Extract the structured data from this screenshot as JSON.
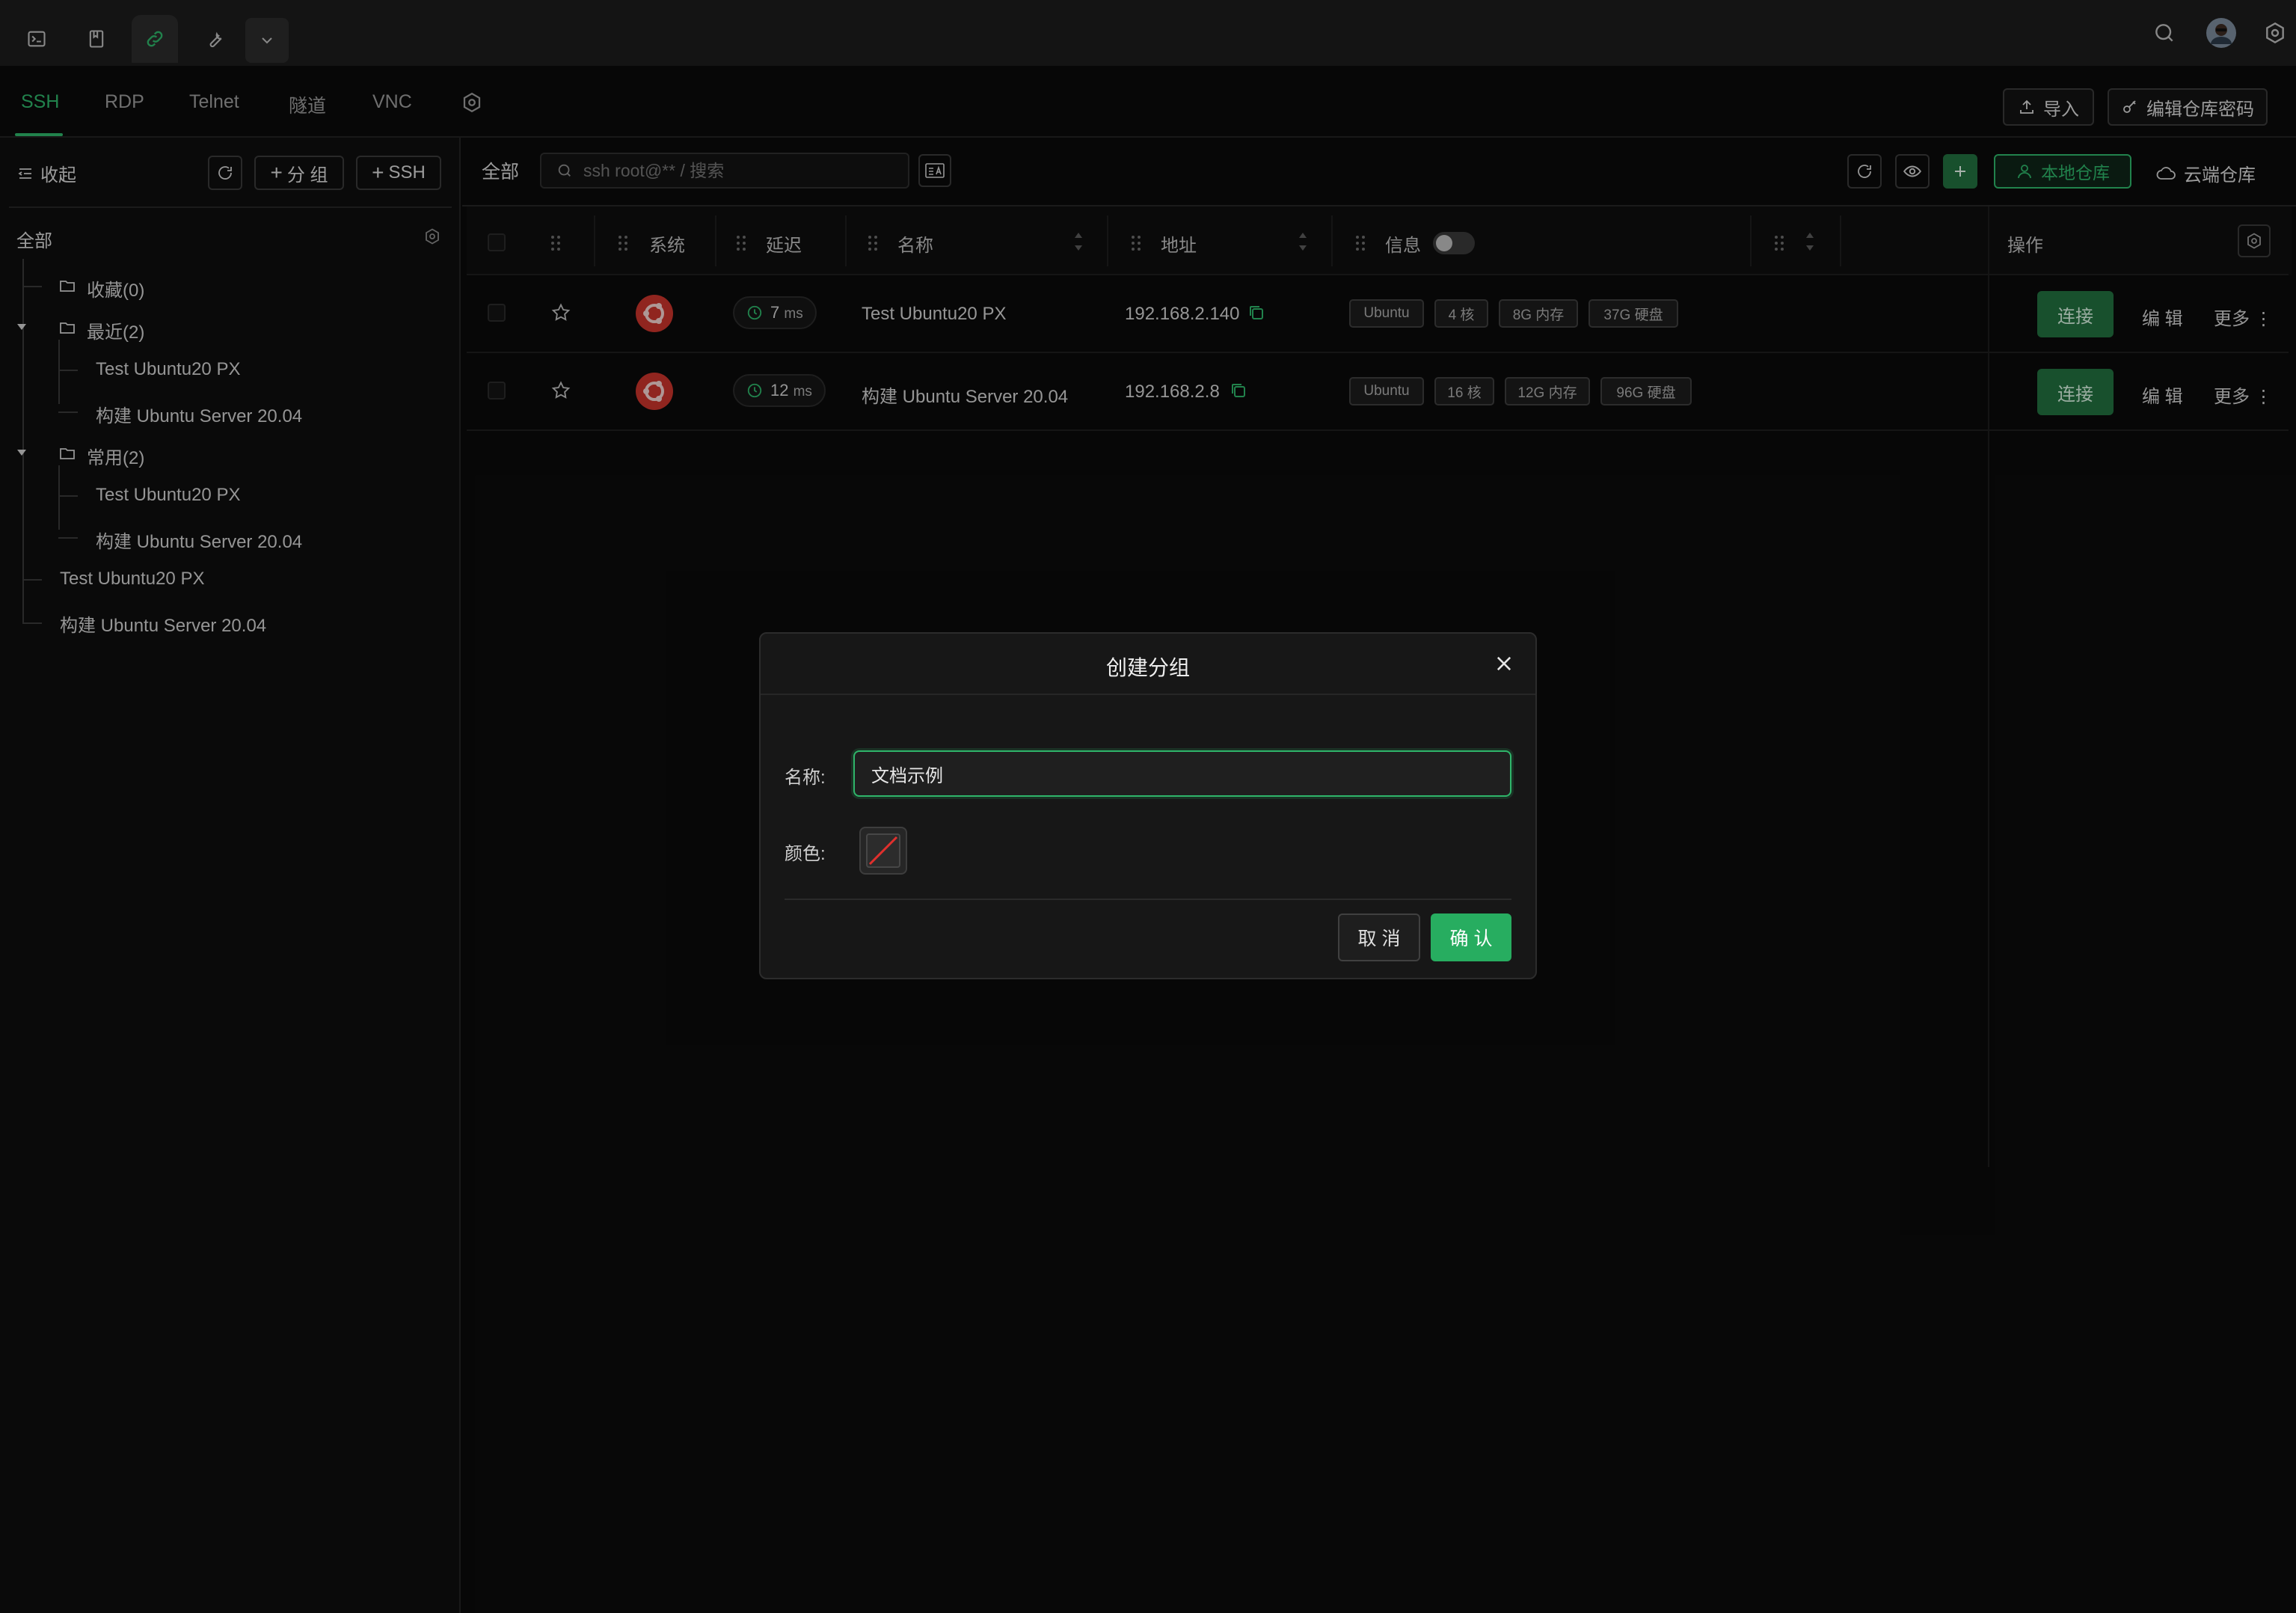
{
  "colors": {
    "accent": "#2fb56a",
    "connect": "#226f3f",
    "ubuntu": "#c8342b",
    "background": "#0b0b0b",
    "topbar": "#1c1c1c"
  },
  "topbar": {
    "tabs": [
      {
        "icon": "terminal-icon"
      },
      {
        "icon": "bookmark-icon"
      },
      {
        "icon": "link-icon",
        "active": true
      },
      {
        "icon": "wrench-icon"
      },
      {
        "icon": "chevron-down-icon"
      }
    ],
    "right_icons": [
      "search-icon",
      "avatar",
      "settings-icon"
    ]
  },
  "protocols": {
    "tabs": [
      "SSH",
      "RDP",
      "Telnet",
      "隧道",
      "VNC"
    ],
    "active": "SSH",
    "import_label": "导入",
    "edit_password_label": "编辑仓库密码"
  },
  "sidebar": {
    "collapse_label": "收起",
    "add_group_label": "分 组",
    "add_ssh_label": "SSH",
    "root_label": "全部",
    "tree": {
      "favorites": "收藏(0)",
      "recent": "最近(2)",
      "recent_items": [
        "Test Ubuntu20 PX",
        "构建 Ubuntu Server 20.04"
      ],
      "common": "常用(2)",
      "common_items": [
        "Test Ubuntu20 PX",
        "构建 Ubuntu Server 20.04"
      ],
      "loose_items": [
        "Test Ubuntu20 PX",
        "构建 Ubuntu Server 20.04"
      ]
    }
  },
  "main": {
    "filter_label": "全部",
    "search_placeholder": "ssh root@** / 搜索",
    "local_repo_label": "本地仓库",
    "cloud_repo_label": "云端仓库",
    "columns": {
      "system": "系统",
      "latency": "延迟",
      "name": "名称",
      "address": "地址",
      "info": "信息",
      "actions": "操作"
    },
    "hosts": [
      {
        "latency_value": "7",
        "latency_unit": "ms",
        "name": "Test Ubuntu20 PX",
        "address": "192.168.2.140",
        "tags": [
          "Ubuntu",
          "4 核",
          "8G 内存",
          "37G 硬盘"
        ],
        "connect_label": "连接",
        "edit_label": "编 辑",
        "more_label": "更多"
      },
      {
        "latency_value": "12",
        "latency_unit": "ms",
        "name": "构建 Ubuntu Server 20.04",
        "address": "192.168.2.8",
        "tags": [
          "Ubuntu",
          "16 核",
          "12G 内存",
          "96G 硬盘"
        ],
        "connect_label": "连接",
        "edit_label": "编 辑",
        "more_label": "更多"
      }
    ]
  },
  "modal": {
    "title": "创建分组",
    "name_label": "名称:",
    "name_value": "文档示例",
    "color_label": "颜色:",
    "cancel_label": "取 消",
    "confirm_label": "确 认"
  }
}
